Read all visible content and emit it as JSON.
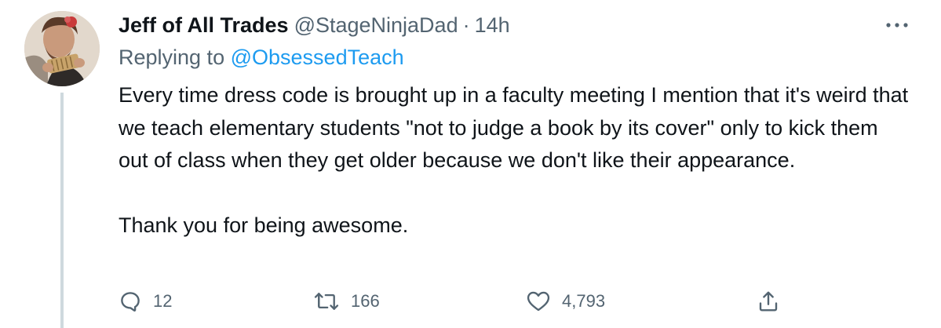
{
  "tweet": {
    "display_name": "Jeff of All Trades",
    "handle": "@StageNinjaDad",
    "separator": "·",
    "time": "14h",
    "replying_prefix": "Replying to",
    "replying_to": "@ObsessedTeach",
    "body": "Every time dress code is brought up in a faculty meeting I mention that it's weird that we teach elementary students \"not to judge a book by its cover\" only to kick them out of class when they get older because we don't like their appearance.\n\nThank you for being awesome.",
    "more_icon": "more-horizontal-icon"
  },
  "actions": {
    "reply": {
      "icon": "reply-icon",
      "count": "12"
    },
    "retweet": {
      "icon": "retweet-icon",
      "count": "166"
    },
    "like": {
      "icon": "heart-icon",
      "count": "4,793"
    },
    "share": {
      "icon": "share-icon"
    }
  },
  "colors": {
    "text_primary": "#0f1419",
    "text_secondary": "#536471",
    "link": "#1d9bf0",
    "thread_line": "#cfd9de"
  }
}
